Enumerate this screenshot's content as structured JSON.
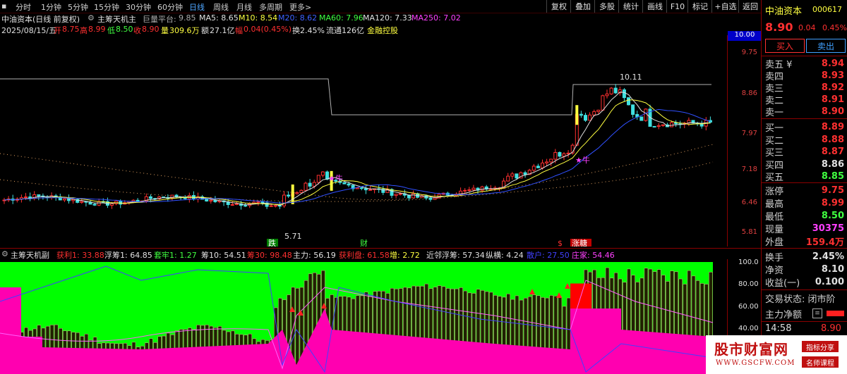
{
  "toolbar": {
    "periods": [
      "分时",
      "1分钟",
      "5分钟",
      "15分钟",
      "30分钟",
      "60分钟",
      "日线",
      "周线",
      "月线",
      "多周期",
      "更多>"
    ],
    "active_period": "日线",
    "buttons": [
      "复权",
      "叠加",
      "多股",
      "统计",
      "画线",
      "F10",
      "标记",
      "+自选",
      "返回"
    ]
  },
  "info": {
    "stock": "中油资本(日线 前复权)",
    "indicator": "主筹天机主",
    "platform_label": "巨量平台:",
    "platform_value": "9.85",
    "ma5": "MA5: 8.65",
    "ma10": "M10: 8.54",
    "ma20": "M20: 8.62",
    "ma60": "MA60: 7.96",
    "ma120": "MA120: 7.33",
    "ma250": "MA250: 7.02",
    "date": "2025/08/15/五",
    "open_label": "开",
    "open": "8.75",
    "high_label": "高",
    "high": "8.99",
    "low_label": "低",
    "low": "8.50",
    "close_label": "收",
    "close": "8.90",
    "vol_label": "量",
    "vol": "309.6万",
    "amt_label": "额",
    "amt": "27.1亿",
    "chg_label": "幅",
    "chg": "0.04(0.45%)",
    "turnover": "换2.45%",
    "float": "流通126亿",
    "concept": "金融控股"
  },
  "main_axis": [
    "9.75",
    "8.86",
    "7.97",
    "7.18",
    "6.46",
    "5.81"
  ],
  "main_axis_top": "10.00",
  "annotations": {
    "peak": "10.11",
    "low": "5.71",
    "label_die": "跌",
    "label_cai": "财",
    "label_s": "$",
    "label_zhang": "涨糖",
    "star_niu": "★牛"
  },
  "sub": {
    "name": "主筹天机副",
    "items": [
      {
        "k": "获利1:",
        "v": "33.88",
        "c": "#ff3030"
      },
      {
        "k": "浮筹1:",
        "v": "64.85",
        "c": "#e0e0e0"
      },
      {
        "k": "套牢1:",
        "v": "1.27",
        "c": "#40ff40"
      },
      {
        "k": "筹10:",
        "v": "54.51",
        "c": "#e0e0e0"
      },
      {
        "k": "筹30:",
        "v": "98.48",
        "c": "#ff3030"
      },
      {
        "k": "主力:",
        "v": "56.19",
        "c": "#e0e0e0"
      },
      {
        "k": "获利盘:",
        "v": "61.58",
        "c": "#ff3030"
      },
      {
        "k": "增:",
        "v": "2.72",
        "c": "#ffff40"
      },
      {
        "k": "近邻浮筹:",
        "v": "57.34",
        "c": "#e0e0e0"
      },
      {
        "k": "纵横:",
        "v": "4.24",
        "c": "#e0e0e0"
      },
      {
        "k": "散户:",
        "v": "27.50",
        "c": "#4040ff"
      },
      {
        "k": "庄家:",
        "v": "54.46",
        "c": "#ff40ff"
      }
    ],
    "axis": [
      "100.0",
      "80.00",
      "60.00",
      "40.00"
    ]
  },
  "panel": {
    "name": "中油资本",
    "code": "000617",
    "price": "8.90",
    "change": "0.04",
    "change_pct": "0.45%",
    "buy_btn": "买入",
    "sell_btn": "卖出",
    "asks": [
      {
        "label": "卖五 ¥",
        "price": "8.94"
      },
      {
        "label": "卖四",
        "price": "8.93"
      },
      {
        "label": "卖三",
        "price": "8.92"
      },
      {
        "label": "卖二",
        "price": "8.91"
      },
      {
        "label": "卖一",
        "price": "8.90"
      }
    ],
    "bids": [
      {
        "label": "买一",
        "price": "8.89",
        "color": "#ff3030"
      },
      {
        "label": "买二",
        "price": "8.88",
        "color": "#ff3030"
      },
      {
        "label": "买三",
        "price": "8.87",
        "color": "#ff3030"
      },
      {
        "label": "买四",
        "price": "8.86",
        "color": "#e0e0e0"
      },
      {
        "label": "买五",
        "price": "8.85",
        "color": "#40ff40"
      }
    ],
    "stats": [
      {
        "label": "涨停",
        "value": "9.75",
        "color": "#ff3030"
      },
      {
        "label": "最高",
        "value": "8.99",
        "color": "#ff3030"
      },
      {
        "label": "最低",
        "value": "8.50",
        "color": "#40ff40"
      },
      {
        "label": "现量",
        "value": "30375",
        "color": "#ff40ff"
      },
      {
        "label": "外盘",
        "value": "159.4万",
        "color": "#ff3030"
      }
    ],
    "stats2": [
      {
        "label": "换手",
        "value": "2.45%",
        "color": "#e0e0e0"
      },
      {
        "label": "净资",
        "value": "8.10",
        "color": "#e0e0e0"
      },
      {
        "label": "收益(一)",
        "value": "0.100",
        "color": "#e0e0e0"
      }
    ],
    "trade_status": "交易状态: 闭市阶",
    "net_flow": "主力净额",
    "time": "14:58",
    "time_price": "8.90"
  },
  "watermark": {
    "title": "股市财富网",
    "url": "WWW.GSCFW.COM",
    "tag1": "指标分享",
    "tag2": "名师课程"
  }
}
